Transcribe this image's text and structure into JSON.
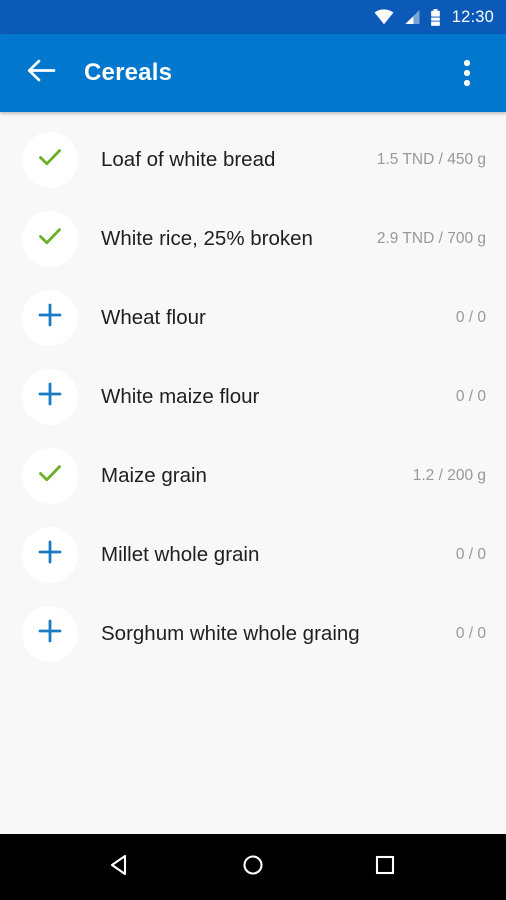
{
  "status_bar": {
    "wifi_icon": "wifi-icon",
    "signal_icon": "cellular-signal-icon",
    "battery_icon": "battery-icon",
    "time": "12:30",
    "background_color": "#0B5AB8"
  },
  "app_bar": {
    "back_icon": "back-arrow-icon",
    "title": "Cereals",
    "overflow_icon": "overflow-menu-icon",
    "background_color": "#0277CE"
  },
  "colors": {
    "check_green": "#6AAF28",
    "plus_blue": "#1B7AC4",
    "value_gray": "#989898",
    "list_background": "#F8F8F9"
  },
  "list": {
    "items": [
      {
        "icon": "check-icon",
        "label": "Loaf of white bread",
        "value": "1.5 TND / 450 g"
      },
      {
        "icon": "check-icon",
        "label": "White rice, 25% broken",
        "value": "2.9 TND / 700 g"
      },
      {
        "icon": "plus-icon",
        "label": "Wheat flour",
        "value": "0 / 0"
      },
      {
        "icon": "plus-icon",
        "label": "White maize flour",
        "value": "0 / 0"
      },
      {
        "icon": "check-icon",
        "label": "Maize grain",
        "value": "1.2 / 200 g"
      },
      {
        "icon": "plus-icon",
        "label": "Millet whole grain",
        "value": "0 / 0"
      },
      {
        "icon": "plus-icon",
        "label": "Sorghum white whole graing",
        "value": "0 / 0"
      }
    ]
  },
  "nav_bar": {
    "back_icon": "nav-back-icon",
    "home_icon": "nav-home-icon",
    "recents_icon": "nav-recents-icon"
  }
}
